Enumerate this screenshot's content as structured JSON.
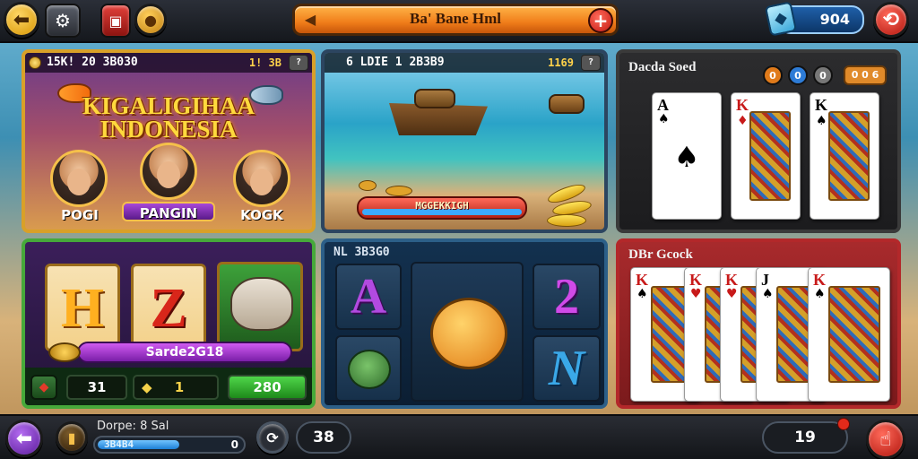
{
  "topbar": {
    "back_icon": "arrow-left-icon",
    "settings_icon": "gear-icon",
    "shop_icon": "bag-icon",
    "cookie_icon": "cookie-icon",
    "title": "Ba' Bane Hml",
    "title_icon": "flag-icon",
    "plus_label": "+",
    "wallet_value": "904",
    "wallet_icon": "gem-icon",
    "refresh_icon": "refresh-icon"
  },
  "panels": {
    "fish_game": {
      "header_left": "15K! 20 3B030",
      "header_right": "1! 3B",
      "title_line1": "KIGALIGIHAA",
      "title_line2": "INDONESIA",
      "players": [
        {
          "name": "POGI"
        },
        {
          "name": "PANGIN"
        },
        {
          "name": "KOGK"
        }
      ]
    },
    "beach_game": {
      "header_left": "6 LDIE  1 2B3B9",
      "header_right": "1169",
      "bar_label": "MGGEKKIGH"
    },
    "card_game": {
      "title": "Dacda Soed",
      "chips": [
        "0",
        "0",
        "0"
      ],
      "badge": "0 0 6",
      "cards": [
        {
          "rank": "A",
          "suit": "♠",
          "color": "black"
        },
        {
          "rank": "K",
          "suit": "♦",
          "color": "red"
        },
        {
          "rank": "K",
          "suit": "♠",
          "color": "black"
        }
      ]
    },
    "slot_game": {
      "reels": [
        "H",
        "Z"
      ],
      "bar_label": "Sarde2G18",
      "stats": [
        "31",
        "1",
        "280"
      ]
    },
    "match_game": {
      "header": "NL 3B3G0",
      "tiles": [
        "A",
        "2",
        "N"
      ]
    },
    "poker_game": {
      "title": "DBr Gcock",
      "cards": [
        {
          "rank": "K",
          "suit": "♠"
        },
        {
          "rank": "K",
          "suit": "♥"
        },
        {
          "rank": "K",
          "suit": "♥"
        },
        {
          "rank": "J",
          "suit": "♠"
        },
        {
          "rank": "K",
          "suit": "♠"
        }
      ]
    }
  },
  "bottombar": {
    "back_icon": "arrow-left-icon",
    "coin_icon": "coin-icon",
    "label": "Dorpe: 8 Sal",
    "progress_text": "3B4B4",
    "progress_end": "0",
    "progress_fraction": 0.55,
    "timer_icon": "timer-icon",
    "counter": "38",
    "right_value": "19",
    "action_icon": "pointer-icon"
  }
}
